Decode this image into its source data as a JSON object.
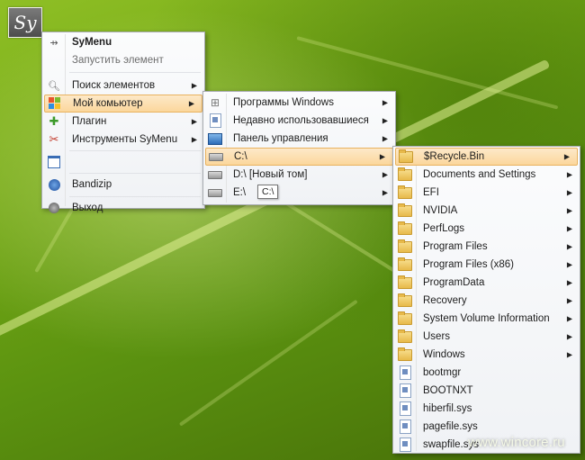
{
  "app": {
    "logo_text": "Sy"
  },
  "main_menu": {
    "title": "SyMenu",
    "subtitle": "Запустить элемент",
    "items": [
      {
        "label": "Поиск элементов",
        "icon": "magnifier-icon"
      },
      {
        "label": "Мой комьютер",
        "icon": "windows-flag-icon",
        "highlighted": true
      },
      {
        "label": "Плагин",
        "icon": "puzzle-icon"
      },
      {
        "label": "Инструменты SyMenu",
        "icon": "tools-icon"
      }
    ],
    "bandizip": "Bandizip",
    "exit": "Выход"
  },
  "computer_menu": {
    "items": [
      {
        "label": "Программы Windows",
        "icon": "programs-grid-icon"
      },
      {
        "label": "Недавно использовавшиеся",
        "icon": "recent-docs-icon"
      },
      {
        "label": "Панель управления",
        "icon": "control-panel-icon"
      },
      {
        "label": "C:\\",
        "icon": "drive-icon",
        "highlighted": true
      },
      {
        "label": "D:\\ [Новый том]",
        "icon": "drive-icon"
      },
      {
        "label": "E:\\",
        "icon": "drive-icon"
      }
    ]
  },
  "tooltip": "C:\\",
  "c_drive_menu": {
    "folders": [
      "$Recycle.Bin",
      "Documents and Settings",
      "EFI",
      "NVIDIA",
      "PerfLogs",
      "Program Files",
      "Program Files (x86)",
      "ProgramData",
      "Recovery",
      "System Volume Information",
      "Users",
      "Windows"
    ],
    "files": [
      "bootmgr",
      "BOOTNXT",
      "hiberfil.sys",
      "pagefile.sys",
      "swapfile.sys"
    ]
  },
  "watermark": "www.wincore.ru"
}
